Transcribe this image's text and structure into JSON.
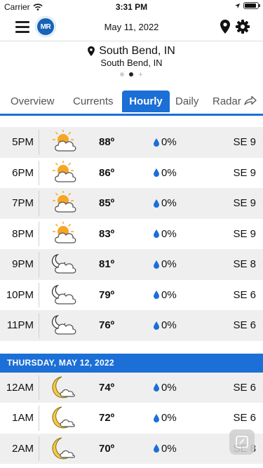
{
  "statusbar": {
    "carrier": "Carrier",
    "time": "3:31 PM",
    "battery_level": 0.9
  },
  "header": {
    "date": "May 11, 2022",
    "logo_text": "MR"
  },
  "location": {
    "name": "South Bend, IN",
    "subtitle": "South Bend, IN",
    "pages": 2,
    "active_page": 1
  },
  "tabs": [
    {
      "label": "Overview",
      "active": false
    },
    {
      "label": "Currents",
      "active": false
    },
    {
      "label": "Hourly",
      "active": true
    },
    {
      "label": "Daily",
      "active": false
    },
    {
      "label": "Radar",
      "active": false
    }
  ],
  "today": [
    {
      "time": "5PM",
      "icon": "partly-sunny-icon",
      "temp": "88º",
      "precip": "0%",
      "wind": "SE 9"
    },
    {
      "time": "6PM",
      "icon": "partly-sunny-icon",
      "temp": "86º",
      "precip": "0%",
      "wind": "SE 9"
    },
    {
      "time": "7PM",
      "icon": "partly-sunny-icon",
      "temp": "85º",
      "precip": "0%",
      "wind": "SE 9"
    },
    {
      "time": "8PM",
      "icon": "partly-sunny-icon",
      "temp": "83º",
      "precip": "0%",
      "wind": "SE 9"
    },
    {
      "time": "9PM",
      "icon": "partly-cloudy-night-icon",
      "temp": "81º",
      "precip": "0%",
      "wind": "SE 8"
    },
    {
      "time": "10PM",
      "icon": "partly-cloudy-night-icon",
      "temp": "79º",
      "precip": "0%",
      "wind": "SE 6"
    },
    {
      "time": "11PM",
      "icon": "partly-cloudy-night-icon",
      "temp": "76º",
      "precip": "0%",
      "wind": "SE 6"
    }
  ],
  "day_header": "THURSDAY, MAY 12, 2022",
  "tomorrow": [
    {
      "time": "12AM",
      "icon": "moon-cloud-icon",
      "temp": "74º",
      "precip": "0%",
      "wind": "SE 6"
    },
    {
      "time": "1AM",
      "icon": "moon-cloud-icon",
      "temp": "72º",
      "precip": "0%",
      "wind": "SE 6"
    },
    {
      "time": "2AM",
      "icon": "moon-cloud-icon",
      "temp": "70º",
      "precip": "0%",
      "wind": "SE 8"
    }
  ],
  "colors": {
    "accent": "#1b6fd6",
    "drop": "#1b6fd6",
    "sun": "#f5a623",
    "moon": "#f2c94c"
  }
}
